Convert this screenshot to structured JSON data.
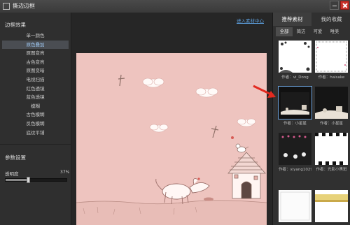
{
  "window": {
    "title": "撕边边框"
  },
  "left": {
    "effects_title": "边框效果",
    "effects": [
      "单一颜色",
      "原色叠加",
      "原图变亮",
      "古色变亮",
      "原图变暗",
      "电视扫描",
      "红色透镜",
      "蓝色透镜",
      "模糊",
      "古色模糊",
      "反色模糊",
      "底纹平铺"
    ],
    "active_index": 1,
    "params_title": "参数设置",
    "opacity_label": "透明度",
    "opacity_value": "37%",
    "opacity_fraction": 0.37
  },
  "center": {
    "enter_link": "进入素材中心"
  },
  "right": {
    "tabs": [
      "推荐素材",
      "我的收藏"
    ],
    "subtabs": [
      "全部",
      "简洁",
      "可爱",
      "唯美"
    ],
    "items": [
      {
        "author": "作者：vi_Dong",
        "style": "flowers-white"
      },
      {
        "author": "作者：haisake",
        "style": "lace-white"
      },
      {
        "author": "作者：小星星",
        "style": "dark-scene",
        "selected": true
      },
      {
        "author": "作者：小星星",
        "style": "dark-scene-2"
      },
      {
        "author": "作者：xiyang1029",
        "style": "dark-cartoon"
      },
      {
        "author": "作者：光影小黑斑",
        "style": "checker"
      },
      {
        "author": "",
        "style": "white"
      },
      {
        "author": "",
        "style": "yellow-strip"
      }
    ]
  },
  "colors": {
    "canvas_bg": "#eec4bf",
    "accent_blue": "#5b9bd8",
    "arrow_red": "#e22a20"
  }
}
